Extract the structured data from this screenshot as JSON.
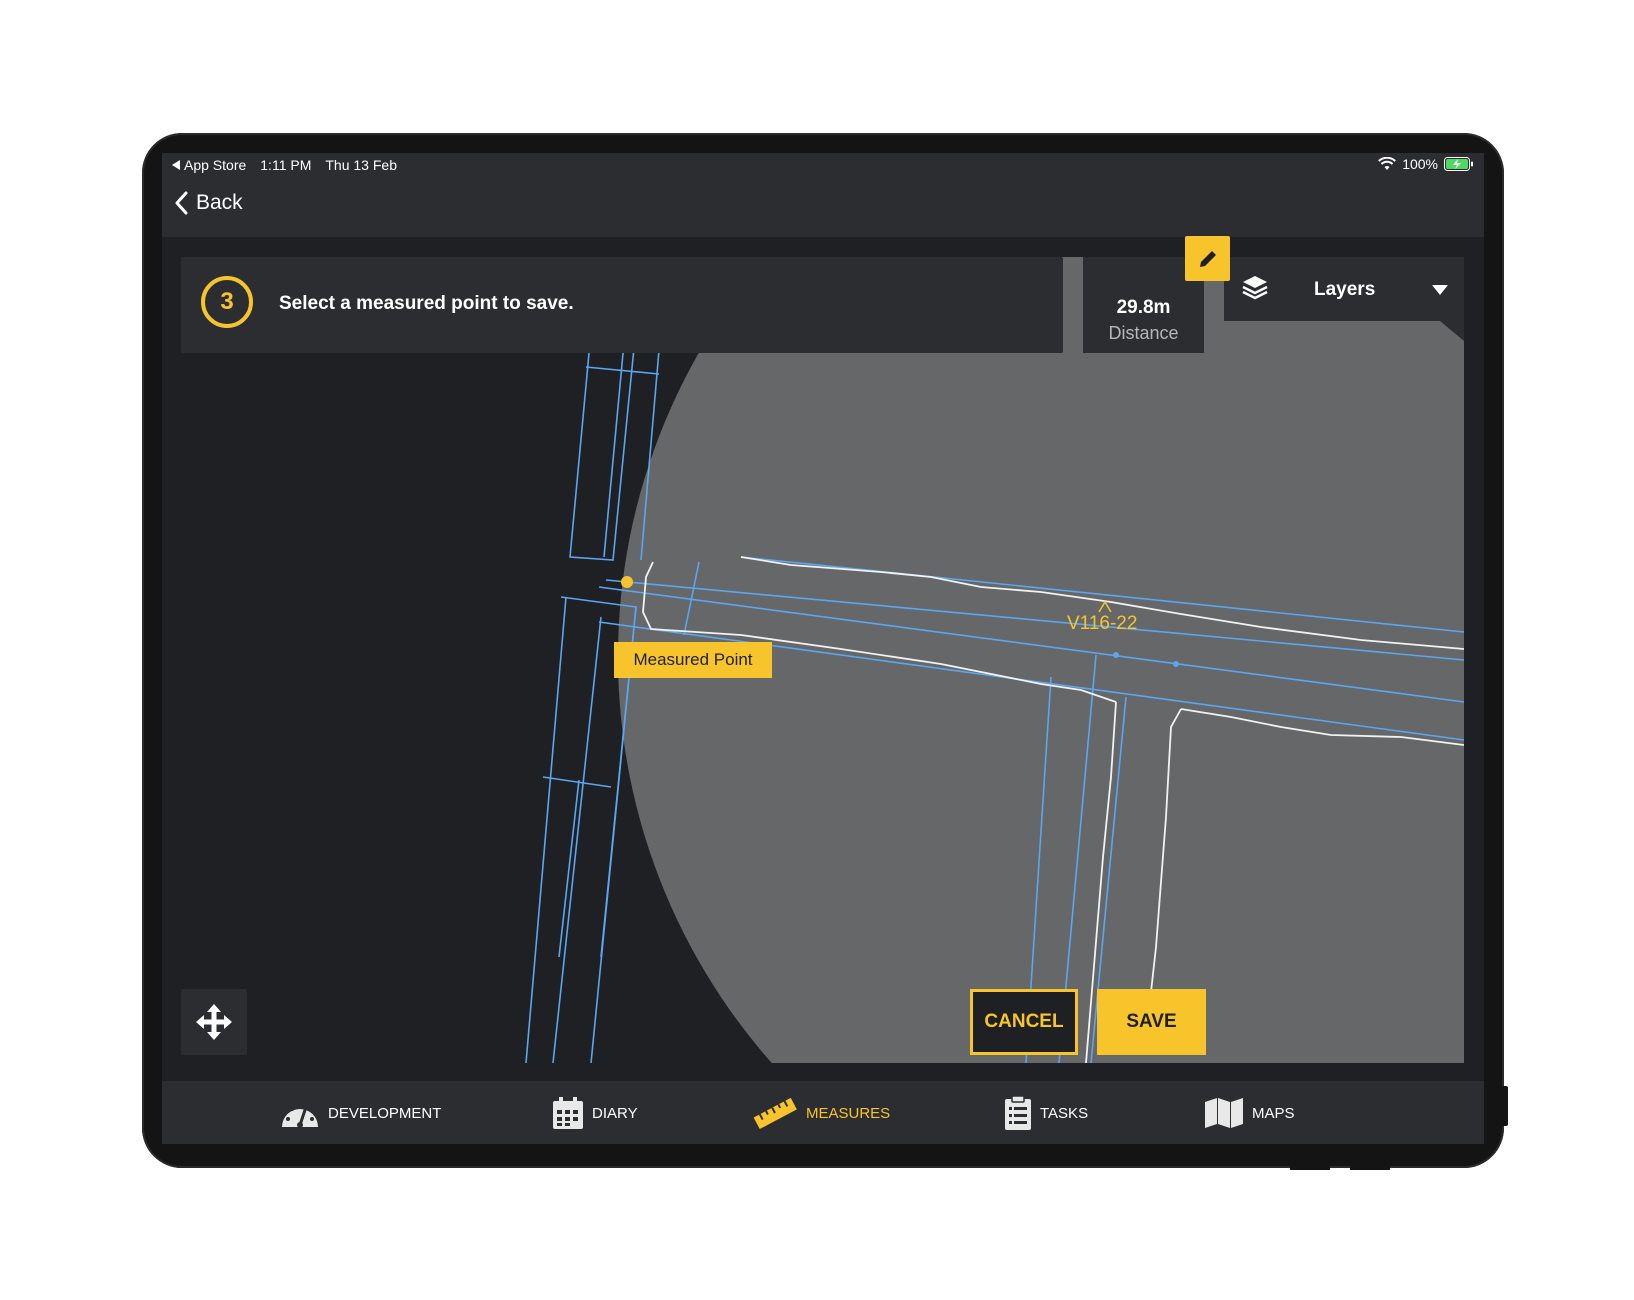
{
  "status_bar": {
    "back_app": "App Store",
    "time": "1:11 PM",
    "date": "Thu 13 Feb",
    "battery": "100%"
  },
  "nav": {
    "back_label": "Back"
  },
  "instruction": {
    "step": "3",
    "text": "Select a measured point to save."
  },
  "distance": {
    "value": "29.8m",
    "label": "Distance"
  },
  "layers": {
    "label": "Layers"
  },
  "map": {
    "point_label": "Measured Point",
    "drive_label": "V116-22"
  },
  "actions": {
    "cancel_label": "CANCEL",
    "save_label": "SAVE"
  },
  "tabs": [
    {
      "label": "DEVELOPMENT",
      "icon": "gauge-icon",
      "active": false
    },
    {
      "label": "DIARY",
      "icon": "calendar-icon",
      "active": false
    },
    {
      "label": "MEASURES",
      "icon": "ruler-icon",
      "active": true
    },
    {
      "label": "TASKS",
      "icon": "clipboard-icon",
      "active": false
    },
    {
      "label": "MAPS",
      "icon": "map-icon",
      "active": false
    }
  ],
  "colors": {
    "accent": "#f7c52b",
    "panel": "#2c2d31",
    "background": "#1f2024",
    "map_circle": "#666769",
    "survey_line": "#5aa6f0"
  }
}
